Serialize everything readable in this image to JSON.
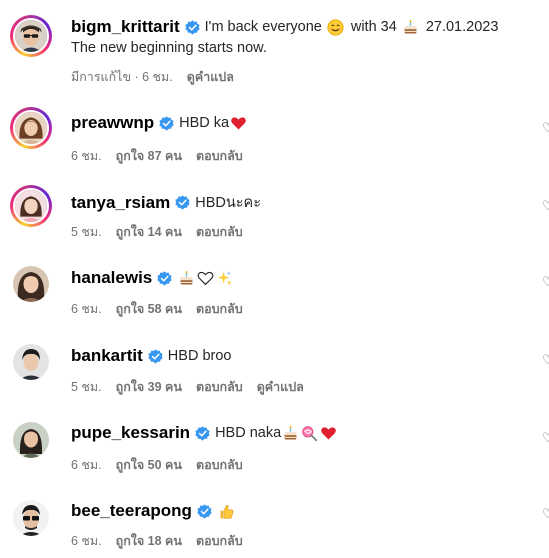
{
  "caption": {
    "username": "bigm_krittarit",
    "text_a": "I'm back everyone",
    "emoji_a": "smile-emoji",
    "text_b": "with 34",
    "emoji_b": "cake-emoji",
    "text_c": "27.01.2023",
    "line2": "The new beginning starts now.",
    "edited": "มีการแก้ไข · 6 ชม.",
    "translate": "ดูคำแปล"
  },
  "comments": [
    {
      "username": "preawwnp",
      "text": "HBD ka",
      "emojis": [
        "red-heart-emoji"
      ],
      "time": "6 ชม.",
      "likes": "ถูกใจ 87 คน",
      "reply": "ตอบกลับ",
      "translate": ""
    },
    {
      "username": "tanya_rsiam",
      "text": "HBDนะคะ",
      "emojis": [],
      "time": "5 ชม.",
      "likes": "ถูกใจ 14 คน",
      "reply": "ตอบกลับ",
      "translate": ""
    },
    {
      "username": "hanalewis",
      "text": "",
      "emojis": [
        "cake-emoji",
        "white-heart-emoji",
        "sparkles-emoji"
      ],
      "time": "6 ชม.",
      "likes": "ถูกใจ 58 คน",
      "reply": "ตอบกลับ",
      "translate": ""
    },
    {
      "username": "bankartit",
      "text": "HBD broo",
      "emojis": [],
      "time": "5 ชม.",
      "likes": "ถูกใจ 39 คน",
      "reply": "ตอบกลับ",
      "translate": "ดูคำแปล"
    },
    {
      "username": "pupe_kessarin",
      "text": "HBD naka",
      "emojis": [
        "cake-emoji",
        "lollipop-emoji",
        "red-heart-emoji"
      ],
      "time": "6 ชม.",
      "likes": "ถูกใจ 50 คน",
      "reply": "ตอบกลับ",
      "translate": ""
    },
    {
      "username": "bee_teerapong",
      "text": "",
      "emojis": [
        "thumbs-up-emoji"
      ],
      "time": "6 ชม.",
      "likes": "ถูกใจ 18 คน",
      "reply": "ตอบกลับ",
      "translate": ""
    }
  ],
  "colors": {
    "verified": "#3897f0",
    "meta_text": "#737373",
    "ring_start": "#f9ce34",
    "ring_mid": "#ee2a7b",
    "ring_end": "#6228d7"
  }
}
